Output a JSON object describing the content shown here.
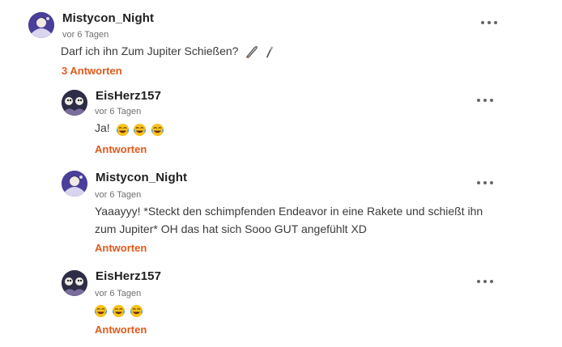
{
  "comments": [
    {
      "username": "Mistycon_Night",
      "time": "vor 6 Tagen",
      "text": "Darf ich ihn Zum Jupiter Schießen?",
      "text_icons": [
        "rocket-icon",
        "knife-icon"
      ],
      "reply_label": "3 Antworten"
    },
    {
      "username": "EisHerz157",
      "time": "vor 6 Tagen",
      "text": "Ja!",
      "text_icons": [
        "laughing-emoji",
        "laughing-emoji",
        "laughing-emoji"
      ],
      "reply_label": "Antworten"
    },
    {
      "username": "Mistycon_Night",
      "time": "vor 6 Tagen",
      "text_line1": "Yaaayyy! *Steckt den schimpfenden Endeavor in eine Rakete und schießt ihn",
      "text_line2": "zum Jupiter* OH das hat sich Sooo GUT angefühlt XD",
      "reply_label": "Antworten"
    },
    {
      "username": "EisHerz157",
      "time": "vor 6 Tagen",
      "text": "",
      "text_icons": [
        "laughing-emoji",
        "laughing-emoji",
        "laughing-emoji"
      ],
      "reply_label": "Antworten"
    }
  ],
  "colors": {
    "accent": "#e2591a",
    "text": "#3a3a3a",
    "muted": "#6f6f6f"
  },
  "icons": {
    "more": "more-options-icon",
    "avatar": "avatar"
  }
}
